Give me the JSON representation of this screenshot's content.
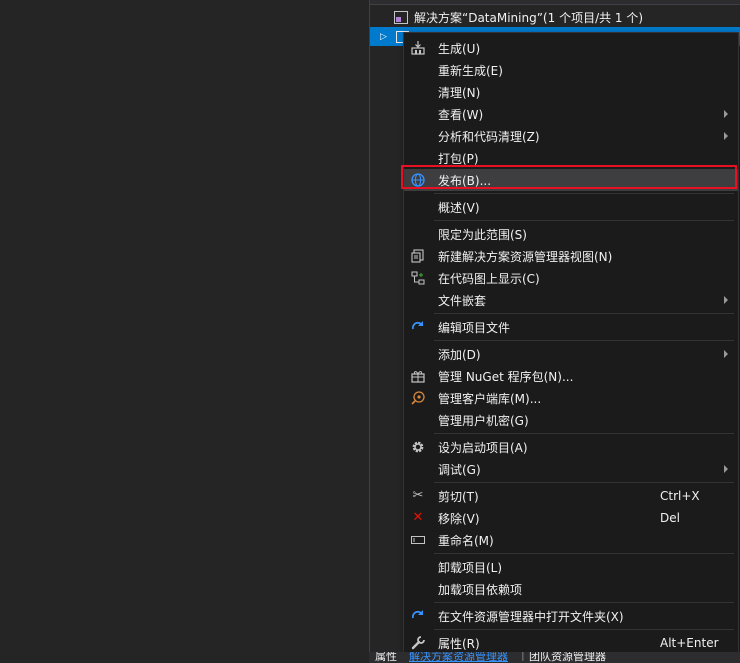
{
  "solution_explorer": {
    "solution_label": "解决方案“DataMining”(1 个项目/共 1 个)"
  },
  "context_menu": {
    "items": [
      {
        "label": "生成(U)",
        "icon": "build-icon"
      },
      {
        "label": "重新生成(E)"
      },
      {
        "label": "清理(N)"
      },
      {
        "label": "查看(W)",
        "submenu": true
      },
      {
        "label": "分析和代码清理(Z)",
        "submenu": true
      },
      {
        "label": "打包(P)"
      },
      {
        "label": "发布(B)...",
        "icon": "globe-icon",
        "highlighted": true
      },
      {
        "label": "概述(V)"
      },
      {
        "label": "限定为此范围(S)"
      },
      {
        "label": "新建解决方案资源管理器视图(N)",
        "icon": "new-view-icon"
      },
      {
        "label": "在代码图上显示(C)",
        "icon": "code-map-icon"
      },
      {
        "label": "文件嵌套",
        "submenu": true
      },
      {
        "label": "编辑项目文件",
        "icon": "edit-project-icon"
      },
      {
        "label": "添加(D)",
        "submenu": true
      },
      {
        "label": "管理 NuGet 程序包(N)...",
        "icon": "nuget-icon"
      },
      {
        "label": "管理客户端库(M)...",
        "icon": "client-library-icon"
      },
      {
        "label": "管理用户机密(G)"
      },
      {
        "label": "设为启动项目(A)",
        "icon": "gear-icon"
      },
      {
        "label": "调试(G)",
        "submenu": true
      },
      {
        "label": "剪切(T)",
        "icon": "scissors-icon",
        "shortcut": "Ctrl+X"
      },
      {
        "label": "移除(V)",
        "icon": "remove-icon",
        "shortcut": "Del"
      },
      {
        "label": "重命名(M)",
        "icon": "rename-icon"
      },
      {
        "label": "卸载项目(L)"
      },
      {
        "label": "加载项目依赖项"
      },
      {
        "label": "在文件资源管理器中打开文件夹(X)",
        "icon": "open-folder-icon"
      },
      {
        "label": "属性(R)",
        "icon": "wrench-icon",
        "shortcut": "Alt+Enter"
      }
    ]
  },
  "bottom_tabs": [
    "属性",
    "解决方案资源管理器",
    "团队资源管理器"
  ],
  "colors": {
    "background": "#252526",
    "menu_background": "#1b1b1c",
    "selection": "#007acc",
    "highlight_border": "#e81123",
    "hover": "#3e3e40"
  }
}
